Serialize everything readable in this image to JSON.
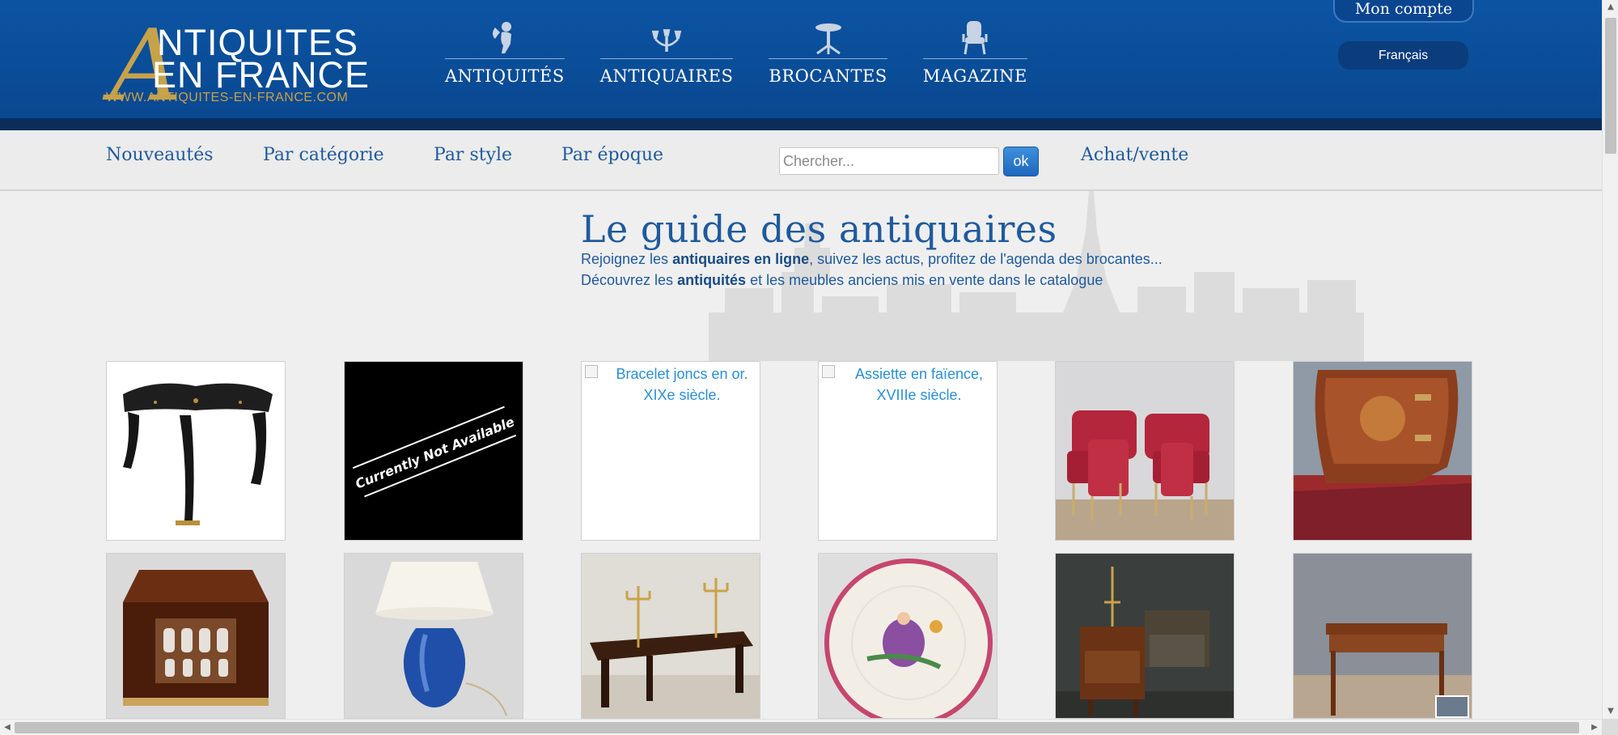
{
  "header": {
    "logo": {
      "initial": "A",
      "line1": "NTIQUITES",
      "line2": "EN FRANCE",
      "url": "WWW.ANTIQUITES-EN-FRANCE.COM"
    },
    "nav": [
      {
        "label": "ANTIQUITÉS",
        "icon": "cherub-icon"
      },
      {
        "label": "ANTIQUAIRES",
        "icon": "chandelier-icon"
      },
      {
        "label": "BROCANTES",
        "icon": "pedestal-table-icon"
      },
      {
        "label": "MAGAZINE",
        "icon": "armchair-icon"
      }
    ],
    "account_label": "Mon compte",
    "language_label": "Français"
  },
  "subnav": {
    "items": [
      "Nouveautés",
      "Par catégorie",
      "Par style",
      "Par époque"
    ],
    "search": {
      "placeholder": "Chercher...",
      "button": "ok"
    },
    "buy_sell": "Achat/vente"
  },
  "hero": {
    "title": "Le guide des antiquaires",
    "line1_pre": "Rejoignez les ",
    "line1_bold": "antiquaires en ligne",
    "line1_post": ", suivez les actus, profitez de l'agenda des brocantes...",
    "line2_pre": "Découvrez les ",
    "line2_bold": "antiquités",
    "line2_post": " et les meubles anciens mis en vente dans le catalogue"
  },
  "grid": {
    "row1": [
      {
        "kind": "image",
        "icon": "black-boulle-table-image"
      },
      {
        "kind": "banner",
        "icon": "not-available-image",
        "text": "Currently Not Available"
      },
      {
        "kind": "broken",
        "alt": "Bracelet joncs en or. XIXe siècle."
      },
      {
        "kind": "broken",
        "alt": "Assiette en faïence, XVIIIe siècle."
      },
      {
        "kind": "image",
        "icon": "red-salon-set-image"
      },
      {
        "kind": "image",
        "icon": "marquetry-commode-image"
      }
    ],
    "row2": [
      {
        "kind": "image",
        "icon": "liquor-cabinet-image"
      },
      {
        "kind": "image",
        "icon": "blue-lamp-image"
      },
      {
        "kind": "image",
        "icon": "farm-table-candelabra-image"
      },
      {
        "kind": "image",
        "icon": "faience-plate-image"
      },
      {
        "kind": "image",
        "icon": "vanity-desk-image"
      },
      {
        "kind": "image",
        "icon": "mahogany-game-table-image"
      }
    ]
  },
  "colors": {
    "header_blue": "#0a4c96",
    "header_stripe": "#0a2d5c",
    "gold": "#c6a24a",
    "link_blue": "#1f5a9c"
  }
}
